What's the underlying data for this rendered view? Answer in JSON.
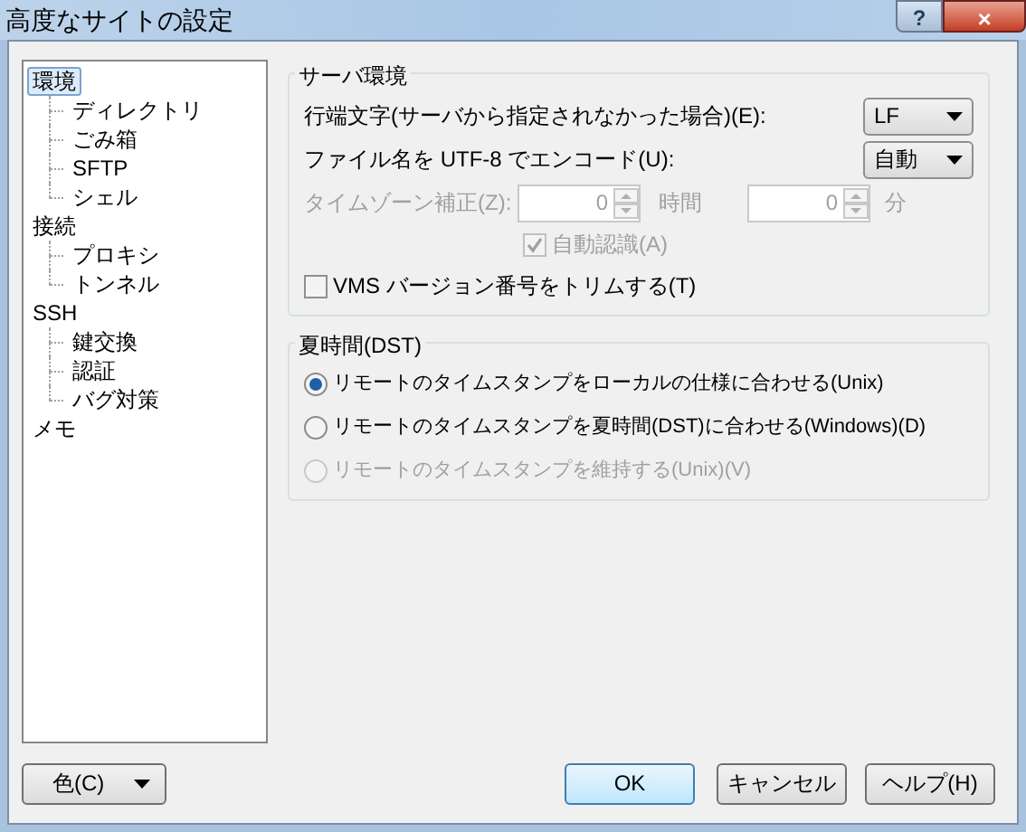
{
  "window": {
    "title": "高度なサイトの設定",
    "buttons": [
      "?",
      "×"
    ]
  },
  "tree": [
    {
      "label": "環境",
      "selected": true,
      "children": [
        {
          "label": "ディレクトリ",
          "selected": false
        },
        {
          "label": "ごみ箱",
          "selected": false
        },
        {
          "label": "SFTP",
          "selected": false
        },
        {
          "label": "シェル",
          "selected": false
        }
      ]
    },
    {
      "label": "接続",
      "selected": false,
      "children": [
        {
          "label": "プロキシ",
          "selected": false
        },
        {
          "label": "トンネル",
          "selected": false
        }
      ]
    },
    {
      "label": "SSH",
      "selected": false,
      "children": [
        {
          "label": "鍵交換",
          "selected": false
        },
        {
          "label": "認証",
          "selected": false
        },
        {
          "label": "バグ対策",
          "selected": false
        }
      ]
    },
    {
      "label": "メモ",
      "selected": false
    }
  ],
  "server_env": {
    "title": "サーバ環境",
    "line_ending": {
      "label": "行端文字(サーバから指定されなかった場合)(E):",
      "value": "LF"
    },
    "utf8": {
      "label": "ファイル名を UTF-8 でエンコード(U):",
      "value": "自動"
    },
    "timezone": {
      "label": "タイムゾーン補正(Z):",
      "disabled": true,
      "hours": "0",
      "hours_unit": "時間",
      "minutes": "0",
      "minutes_unit": "分"
    },
    "auto_detect": {
      "label": "自動認識(A)",
      "checked": true,
      "disabled": true
    },
    "vms": {
      "label": "VMS バージョン番号をトリムする(T)",
      "checked": false,
      "disabled": false
    }
  },
  "dst": {
    "title": "夏時間(DST)",
    "options": [
      {
        "label": "リモートのタイムスタンプをローカルの仕様に合わせる(Unix)",
        "selected": true,
        "disabled": false
      },
      {
        "label": "リモートのタイムスタンプを夏時間(DST)に合わせる(Windows)(D)",
        "selected": false,
        "disabled": false
      },
      {
        "label": "リモートのタイムスタンプを維持する(Unix)(V)",
        "selected": false,
        "disabled": true
      }
    ]
  },
  "footer": {
    "color_button": "色(C)",
    "ok": "OK",
    "cancel": "キャンセル",
    "help": "ヘルプ(H)"
  }
}
